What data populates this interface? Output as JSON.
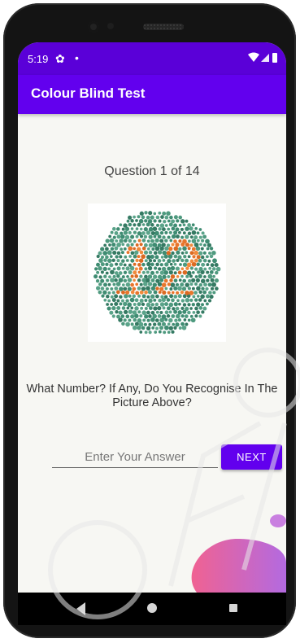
{
  "status_bar": {
    "time": "5:19",
    "settings_icon": "gear-icon",
    "notification_dot": "•",
    "wifi_icon": "wifi-icon",
    "signal_icon": "cell-signal-icon",
    "battery_icon": "battery-icon"
  },
  "app_bar": {
    "title": "Colour Blind Test"
  },
  "quiz": {
    "question_counter": "Question 1 of 14",
    "plate_number": "12",
    "prompt": "What Number? If Any, Do You Recognise In The Picture Above?",
    "answer_placeholder": "Enter Your Answer",
    "answer_value": "",
    "next_label": "NEXT"
  },
  "nav_bar": {
    "back_icon": "back-triangle-icon",
    "home_icon": "home-circle-icon",
    "recents_icon": "recents-square-icon"
  },
  "colors": {
    "status_bar": "#5a00d8",
    "app_bar": "#6200ee",
    "button": "#6200ee",
    "plate_background_dots": "#3f8c72",
    "plate_figure_dots": "#e8762c",
    "blob_pink": "#f06292",
    "blob_violet": "#b36ae0"
  }
}
